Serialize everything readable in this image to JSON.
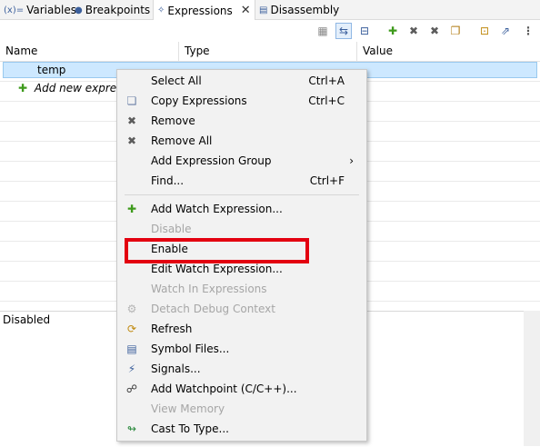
{
  "tabs": [
    {
      "icon": "(x)=",
      "label": "Variables"
    },
    {
      "icon": "●",
      "label": "Breakpoints"
    },
    {
      "icon": "✧",
      "label": "Expressions"
    },
    {
      "icon": "▤",
      "label": "Disassembly"
    }
  ],
  "columns": [
    "Name",
    "Type",
    "Value"
  ],
  "rows": {
    "temp": "temp",
    "add_new": "Add new express"
  },
  "detail": "Disabled",
  "menu": [
    {
      "label": "Select All",
      "accel": "Ctrl+A",
      "icon": "",
      "enabled": true
    },
    {
      "label": "Copy Expressions",
      "accel": "Ctrl+C",
      "icon": "copy-icon",
      "enabled": true
    },
    {
      "label": "Remove",
      "accel": "",
      "icon": "remove-icon",
      "enabled": true
    },
    {
      "label": "Remove All",
      "accel": "",
      "icon": "remove-all-icon",
      "enabled": true
    },
    {
      "label": "Add Expression Group",
      "accel": "›",
      "icon": "",
      "enabled": true
    },
    {
      "label": "Find...",
      "accel": "Ctrl+F",
      "icon": "",
      "enabled": true
    },
    {
      "label": "Add Watch Expression...",
      "accel": "",
      "icon": "add-icon",
      "enabled": true
    },
    {
      "label": "Disable",
      "accel": "",
      "icon": "",
      "enabled": false
    },
    {
      "label": "Enable",
      "accel": "",
      "icon": "",
      "enabled": true
    },
    {
      "label": "Edit Watch Expression...",
      "accel": "",
      "icon": "",
      "enabled": true
    },
    {
      "label": "Watch In Expressions",
      "accel": "",
      "icon": "",
      "enabled": false
    },
    {
      "label": "Detach Debug Context",
      "accel": "",
      "icon": "detach-icon",
      "enabled": false
    },
    {
      "label": "Refresh",
      "accel": "",
      "icon": "refresh-icon",
      "enabled": true
    },
    {
      "label": "Symbol Files...",
      "accel": "",
      "icon": "symbol-files-icon",
      "enabled": true
    },
    {
      "label": "Signals...",
      "accel": "",
      "icon": "signals-icon",
      "enabled": true
    },
    {
      "label": "Add Watchpoint (C/C++)...",
      "accel": "",
      "icon": "watchpoint-icon",
      "enabled": true
    },
    {
      "label": "View Memory",
      "accel": "",
      "icon": "",
      "enabled": false
    },
    {
      "label": "Cast To Type...",
      "accel": "",
      "icon": "cast-icon",
      "enabled": true
    }
  ],
  "colors": {
    "accent": "#cde8ff",
    "highlight": "#e30010"
  }
}
